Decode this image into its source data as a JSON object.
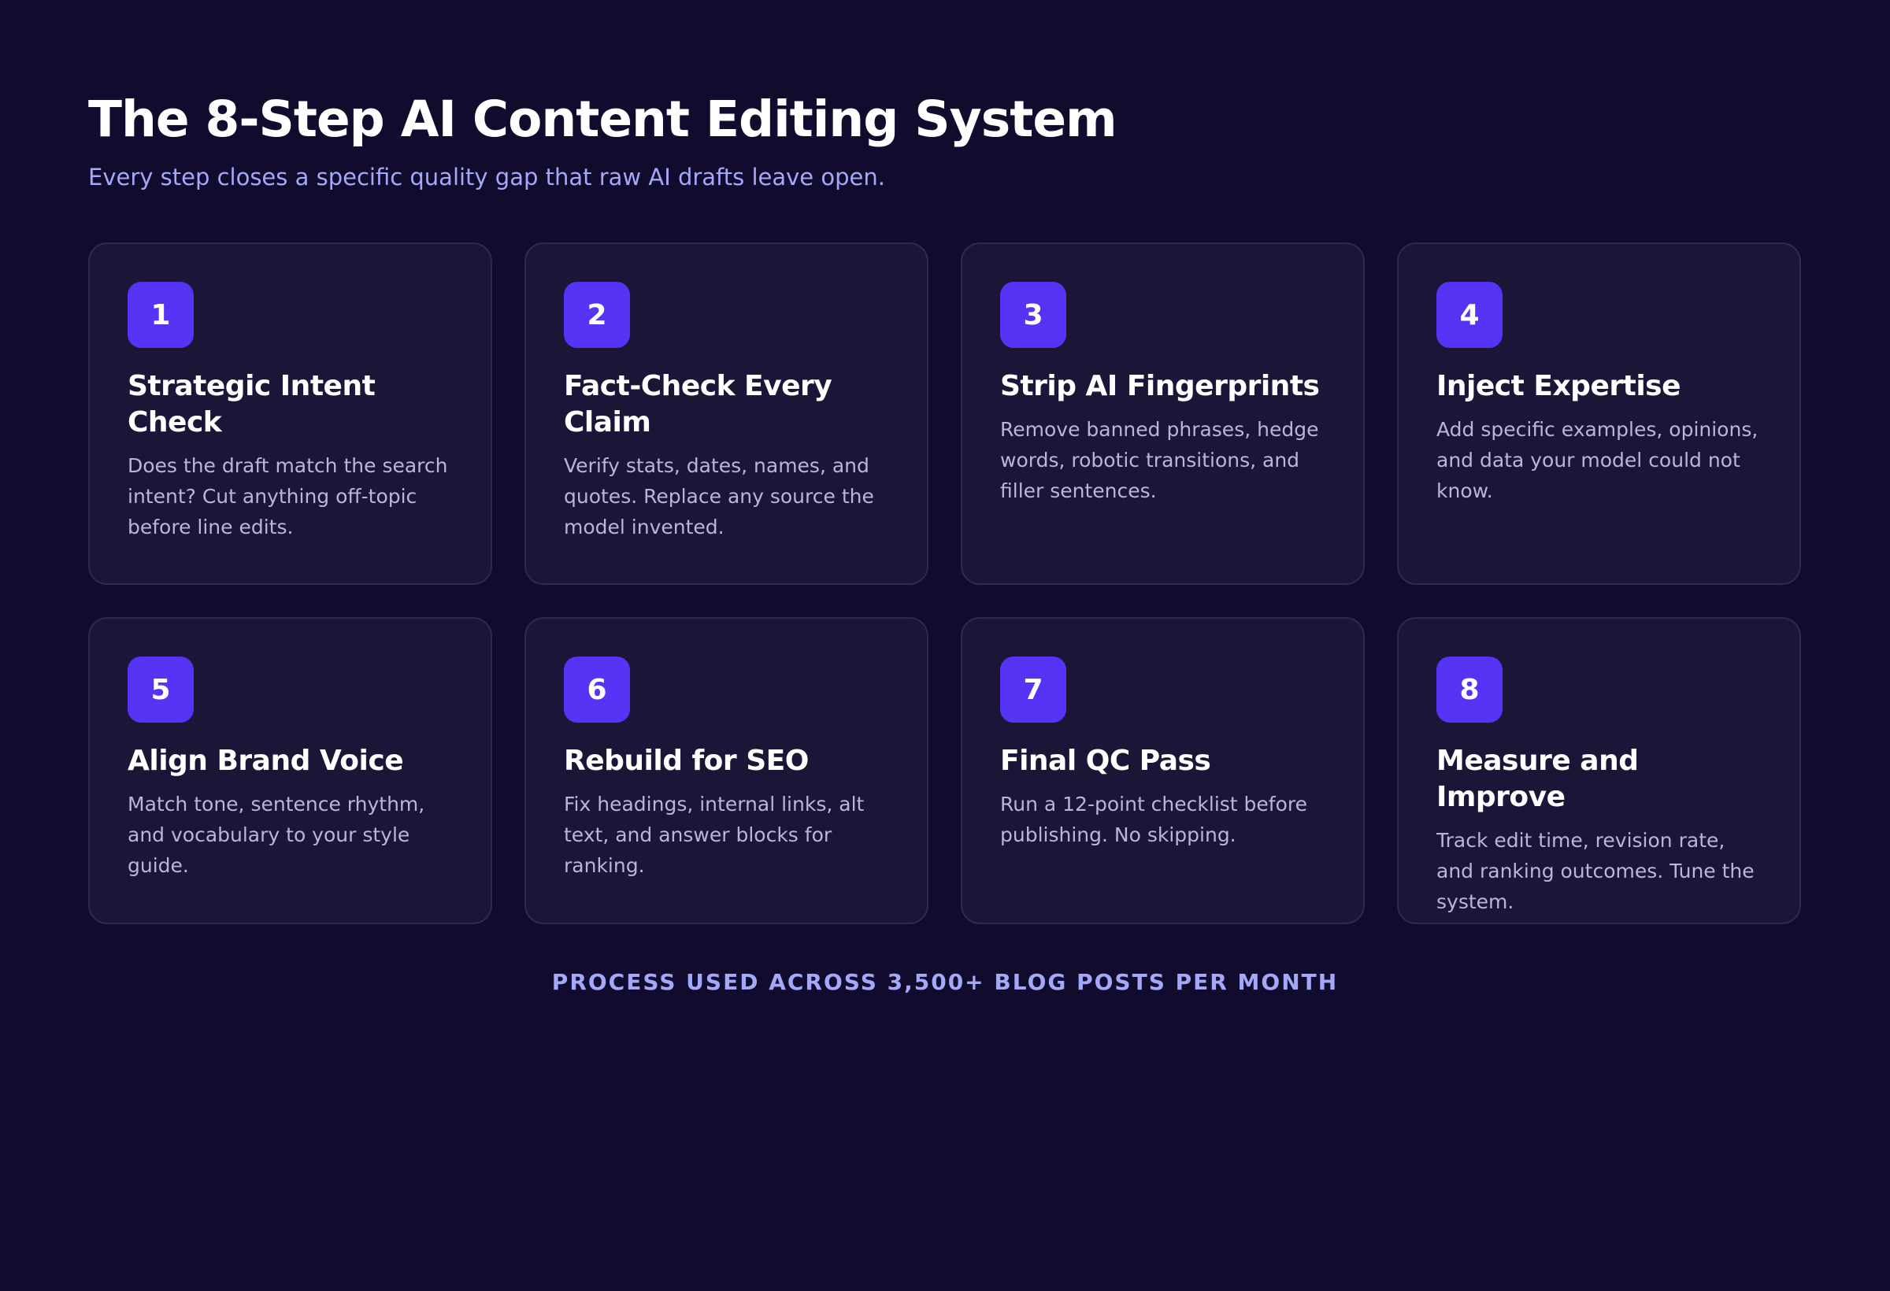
{
  "header": {
    "title": "The 8-Step AI Content Editing System",
    "subtitle": "Every step closes a specific quality gap that raw AI drafts leave open."
  },
  "steps": [
    {
      "number": "1",
      "title": "Strategic Intent Check",
      "description": "Does the draft match the search intent? Cut anything off-topic before line edits."
    },
    {
      "number": "2",
      "title": "Fact-Check Every Claim",
      "description": "Verify stats, dates, names, and quotes. Replace any source the model invented."
    },
    {
      "number": "3",
      "title": "Strip AI Fingerprints",
      "description": "Remove banned phrases, hedge words, robotic transitions, and filler sentences."
    },
    {
      "number": "4",
      "title": "Inject Expertise",
      "description": "Add specific examples, opinions, and data your model could not know."
    },
    {
      "number": "5",
      "title": "Align Brand Voice",
      "description": "Match tone, sentence rhythm, and vocabulary to your style guide."
    },
    {
      "number": "6",
      "title": "Rebuild for SEO",
      "description": "Fix headings, internal links, alt text, and answer blocks for ranking."
    },
    {
      "number": "7",
      "title": "Final QC Pass",
      "description": "Run a 12-point checklist before publishing. No skipping."
    },
    {
      "number": "8",
      "title": "Measure and Improve",
      "description": "Track edit time, revision rate, and ranking outcomes. Tune the system."
    }
  ],
  "footer": {
    "note": "PROCESS USED ACROSS 3,500+ BLOG POSTS PER MONTH"
  },
  "colors": {
    "background": "#110c2e",
    "card": "#1b1638",
    "card_border": "#2e2852",
    "badge": "#5733f6",
    "accent_text": "#a4a8f8"
  }
}
